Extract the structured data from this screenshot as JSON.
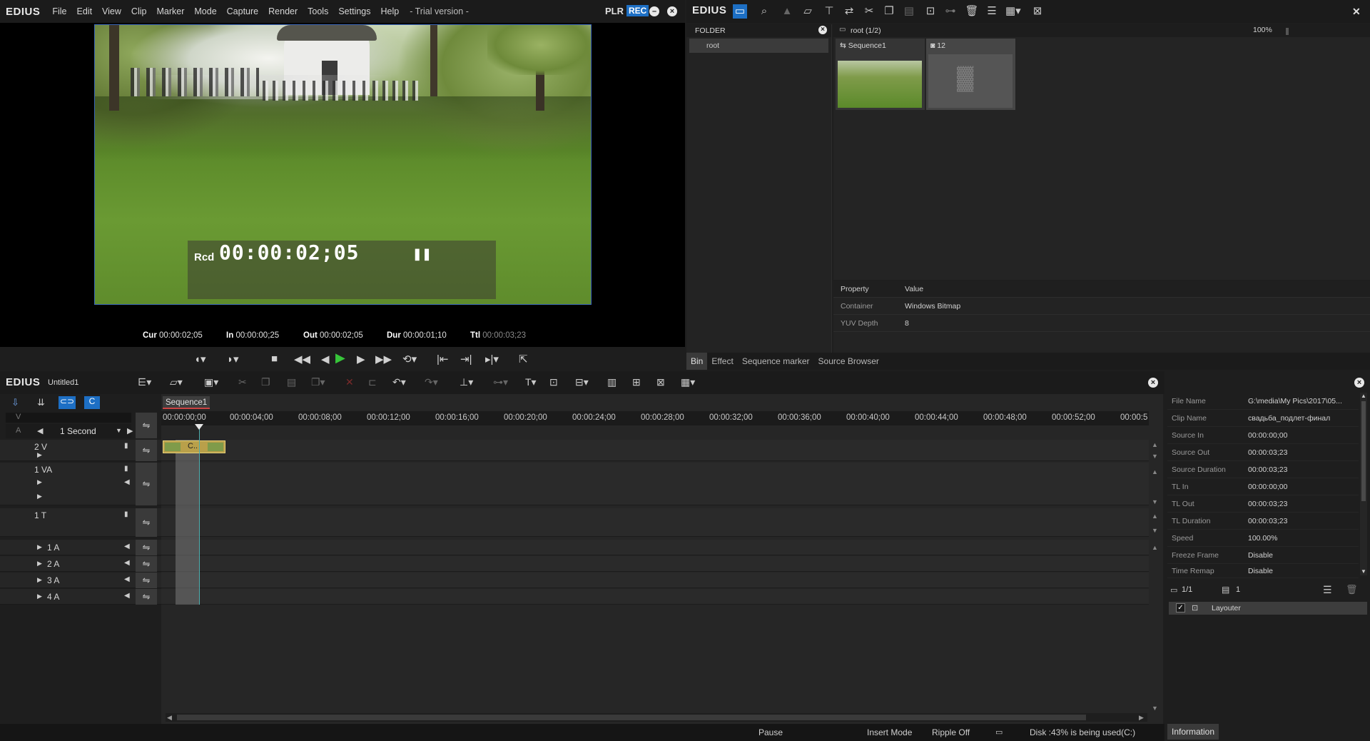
{
  "player": {
    "app_name": "EDIUS",
    "menu": [
      "File",
      "Edit",
      "View",
      "Clip",
      "Marker",
      "Mode",
      "Capture",
      "Render",
      "Tools",
      "Settings",
      "Help"
    ],
    "trial_text": "- Trial version -",
    "plr_label": "PLR",
    "rec_label": "REC",
    "rcd_label": "Rcd",
    "rcd_time": "00:00:02;05",
    "timecodes": {
      "cur_label": "Cur",
      "cur": "00:00:02;05",
      "in_label": "In",
      "in": "00:00:00;25",
      "out_label": "Out",
      "out": "00:00:02;05",
      "dur_label": "Dur",
      "dur": "00:00:01;10",
      "ttl_label": "Ttl",
      "ttl": "00:00:03;23"
    }
  },
  "bin": {
    "app_name": "EDIUS",
    "folder_header": "FOLDER",
    "root_label": "root",
    "path_label": "root (1/2)",
    "zoom": "100%",
    "clips": [
      {
        "name": "Sequence1"
      },
      {
        "name": "12"
      }
    ],
    "property_header": {
      "k": "Property",
      "v": "Value"
    },
    "properties": [
      {
        "k": "Container",
        "v": "Windows Bitmap"
      },
      {
        "k": "YUV Depth",
        "v": "8"
      }
    ],
    "tabs": [
      "Bin",
      "Effect",
      "Sequence marker",
      "Source Browser"
    ]
  },
  "timeline": {
    "app_name": "EDIUS",
    "project_name": "Untitled1",
    "sequence_tab": "Sequence1",
    "scale": "1 Second",
    "v_label": "V",
    "a_label": "A",
    "clip_label": "C..",
    "ruler": [
      "00:00:00;00",
      "00:00:04;00",
      "00:00:08;00",
      "00:00:12;00",
      "00:00:16;00",
      "00:00:20;00",
      "00:00:24;00",
      "00:00:28;00",
      "00:00:32;00",
      "00:00:36;00",
      "00:00:40;00",
      "00:00:44;00",
      "00:00:48;00",
      "00:00:52;00",
      "00:00:5"
    ],
    "tracks": [
      {
        "name": "2 V"
      },
      {
        "name": "1 VA"
      },
      {
        "name": "1 T"
      },
      {
        "name": "1 A"
      },
      {
        "name": "2 A"
      },
      {
        "name": "3 A"
      },
      {
        "name": "4 A"
      }
    ]
  },
  "info": {
    "rows": [
      {
        "k": "File Name",
        "v": "G:\\media\\My Pics\\2017\\05..."
      },
      {
        "k": "Clip Name",
        "v": "свадьба_подлет-финал"
      },
      {
        "k": "Source In",
        "v": "00:00:00;00"
      },
      {
        "k": "Source Out",
        "v": "00:00:03;23"
      },
      {
        "k": "Source Duration",
        "v": "00:00:03;23"
      },
      {
        "k": "TL In",
        "v": "00:00:00;00"
      },
      {
        "k": "TL Out",
        "v": "00:00:03;23"
      },
      {
        "k": "TL Duration",
        "v": "00:00:03;23"
      },
      {
        "k": "Speed",
        "v": "100.00%"
      },
      {
        "k": "Freeze Frame",
        "v": "Disable"
      },
      {
        "k": "Time Remap",
        "v": "Disable"
      }
    ],
    "page": "1/1",
    "count": "1",
    "effect_name": "Layouter",
    "tab": "Information"
  },
  "status": {
    "pause": "Pause",
    "insert_mode": "Insert Mode",
    "ripple": "Ripple Off",
    "disk": "Disk :43% is being used(C:)"
  }
}
